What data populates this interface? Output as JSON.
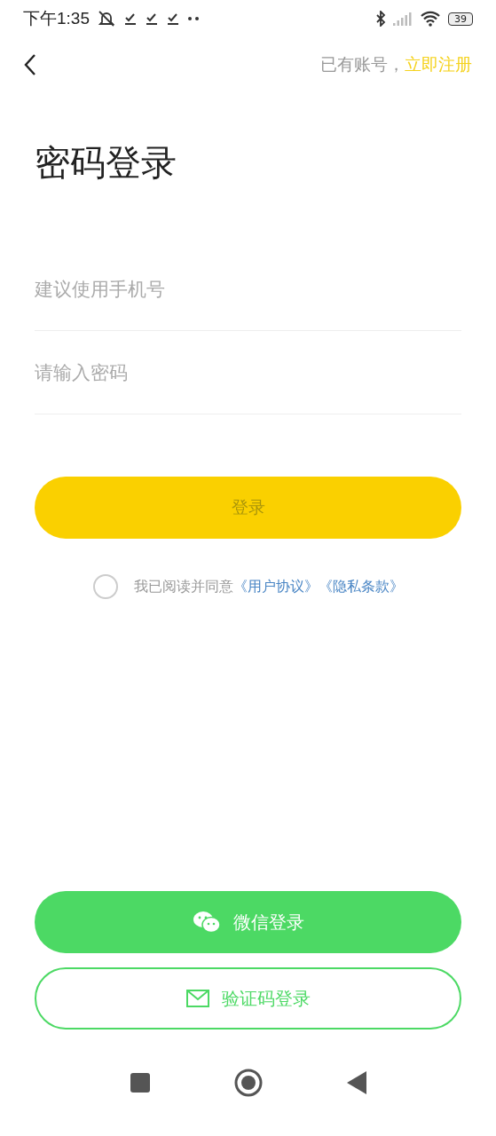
{
  "status_bar": {
    "time": "下午1:35",
    "battery": "39"
  },
  "header": {
    "prompt": "已有账号，",
    "register_link": "立即注册"
  },
  "title": "密码登录",
  "fields": [
    {
      "placeholder": "建议使用手机号"
    },
    {
      "placeholder": "请输入密码"
    }
  ],
  "login_button": {
    "label": "登录",
    "disabled": true
  },
  "agreement": {
    "checked": false,
    "text": "我已阅读并同意",
    "links": [
      "《用户协议》",
      "《隐私条款》"
    ]
  },
  "alt_logins": [
    {
      "label": "微信登录",
      "kind": "wechat"
    },
    {
      "label": "验证码登录",
      "kind": "sms"
    }
  ]
}
